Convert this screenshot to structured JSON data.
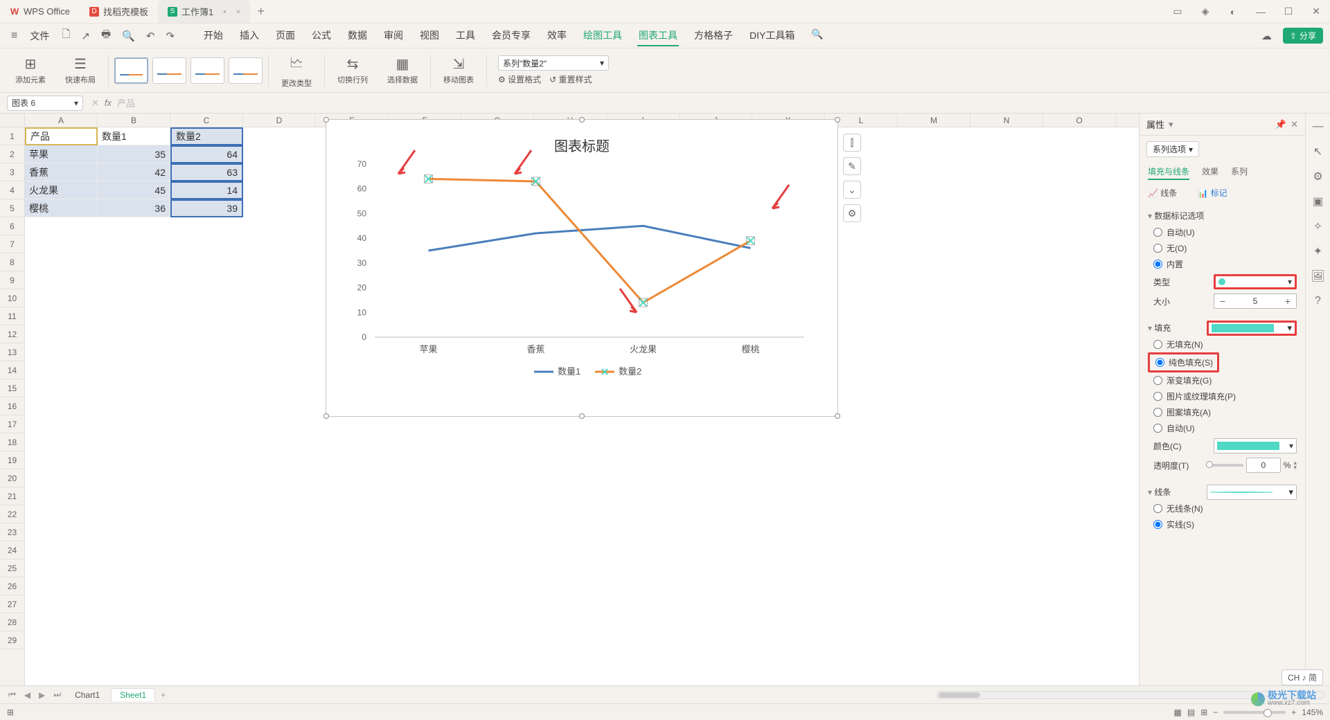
{
  "app": {
    "name": "WPS Office"
  },
  "tabs": [
    {
      "label": "找稻壳模板",
      "icon": "D"
    },
    {
      "label": "工作簿1",
      "icon": "S",
      "active": true
    }
  ],
  "file_menu": "文件",
  "menu": {
    "items": [
      "开始",
      "插入",
      "页面",
      "公式",
      "数据",
      "审阅",
      "视图",
      "工具",
      "会员专享",
      "效率",
      "绘图工具",
      "图表工具",
      "方格格子",
      "DIY工具箱"
    ],
    "active1": "绘图工具",
    "active2": "图表工具"
  },
  "share_label": "分享",
  "ribbon": {
    "add_element": "添加元素",
    "quick_layout": "快速布局",
    "change_type": "更改类型",
    "switch_rowcol": "切换行列",
    "select_data": "选择数据",
    "move_chart": "移动图表",
    "series_selector": "系列\"数量2\"",
    "set_format": "设置格式",
    "reset_style": "重置样式"
  },
  "namebox": "图表 6",
  "formula": "产品",
  "columns": [
    "A",
    "B",
    "C",
    "D",
    "E",
    "F",
    "G",
    "H",
    "I",
    "J",
    "K",
    "L",
    "M",
    "N",
    "O"
  ],
  "rows": 29,
  "table": {
    "headers": [
      "产品",
      "数量1",
      "数量2"
    ],
    "rows": [
      {
        "p": "苹果",
        "q1": 35,
        "q2": 64
      },
      {
        "p": "香蕉",
        "q1": 42,
        "q2": 63
      },
      {
        "p": "火龙果",
        "q1": 45,
        "q2": 14
      },
      {
        "p": "樱桃",
        "q1": 36,
        "q2": 39
      }
    ]
  },
  "chart_data": {
    "type": "line",
    "title": "图表标题",
    "categories": [
      "苹果",
      "香蕉",
      "火龙果",
      "樱桃"
    ],
    "series": [
      {
        "name": "数量1",
        "values": [
          35,
          42,
          45,
          36
        ],
        "color": "#4a7ebb"
      },
      {
        "name": "数量2",
        "values": [
          64,
          63,
          14,
          39
        ],
        "color": "#ed8936",
        "marker": "x",
        "marker_fill": "#4fd9c4"
      }
    ],
    "ylim": [
      0,
      70
    ],
    "yticks": [
      0,
      10,
      20,
      30,
      40,
      50,
      60,
      70
    ],
    "legend_position": "bottom"
  },
  "side_panel": {
    "title": "属性",
    "series_options": "系列选项",
    "tabs": [
      "填充与线条",
      "效果",
      "系列"
    ],
    "active_tab": "填充与线条",
    "sub_line": "线条",
    "sub_marker": "标记",
    "marker_section": "数据标记选项",
    "marker_auto": "自动(U)",
    "marker_none": "无(O)",
    "marker_builtin": "内置",
    "type_label": "类型",
    "size_label": "大小",
    "size_value": "5",
    "fill_section": "填充",
    "fill_none": "无填充(N)",
    "fill_solid": "纯色填充(S)",
    "fill_gradient": "渐变填充(G)",
    "fill_picture": "图片或纹理填充(P)",
    "fill_pattern": "图案填充(A)",
    "fill_auto": "自动(U)",
    "color_label": "颜色(C)",
    "transparency_label": "透明度(T)",
    "transparency_value": "0",
    "transparency_unit": "%",
    "line_section": "线条",
    "line_none": "无线条(N)",
    "line_solid": "实线(S)"
  },
  "sheet_tabs": {
    "items": [
      "Chart1",
      "Sheet1"
    ],
    "active": "Sheet1"
  },
  "statusbar": {
    "zoom": "145%",
    "ime": "CH ♪ 简"
  },
  "watermark": {
    "brand": "极光下载站",
    "url": "www.xz7.com"
  }
}
